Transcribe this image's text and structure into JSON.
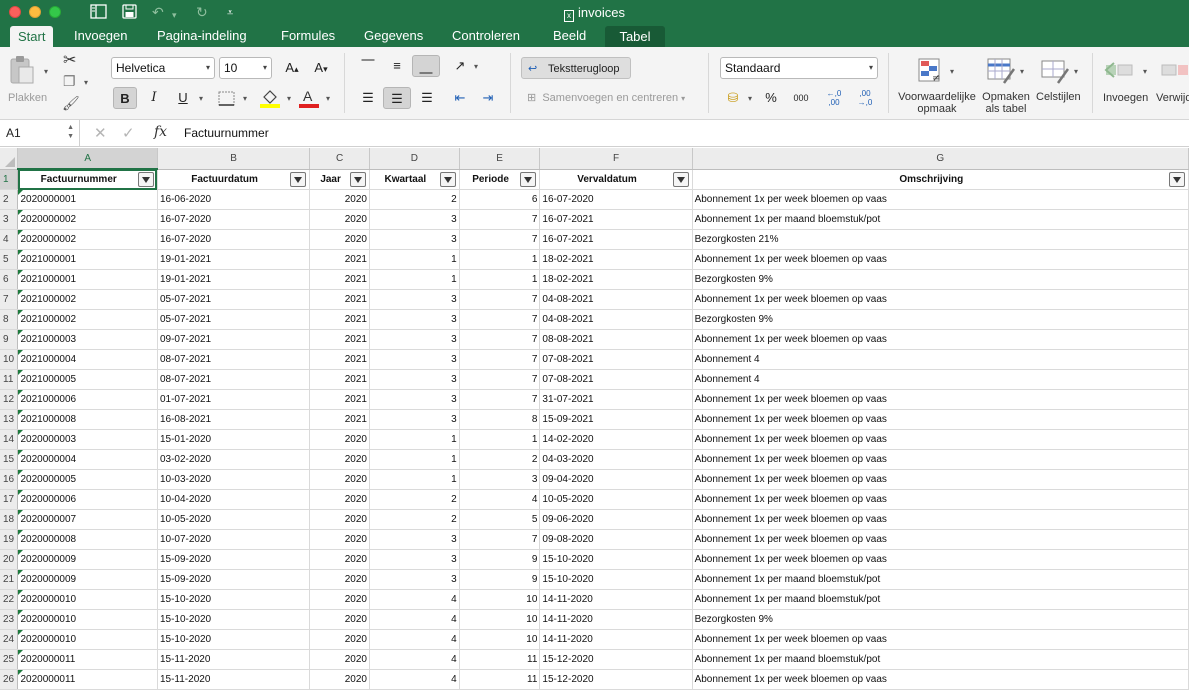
{
  "window": {
    "title": "invoices",
    "colors": {
      "chrome": "#217346",
      "accent": "#217346"
    }
  },
  "quick_access": {
    "icons": [
      "sidebar-icon",
      "save-icon",
      "undo-icon",
      "redo-icon",
      "customize-icon"
    ]
  },
  "tabs": [
    "Start",
    "Invoegen",
    "Pagina-indeling",
    "Formules",
    "Gegevens",
    "Controleren",
    "Beeld",
    "Tabel"
  ],
  "ribbon": {
    "paste_label": "Plakken",
    "font_name": "Helvetica",
    "font_size": "10",
    "wrap_text_label": "Tekstterugloop",
    "merge_label": "Samenvoegen en centreren",
    "number_format": "Standaard",
    "percent_symbol": "%",
    "thousands_symbol": "000",
    "conditional_label": "Voorwaardelijke opmaak",
    "format_table_label": "Opmaken als tabel",
    "cell_styles_label": "Celstijlen",
    "insert_label": "Invoegen",
    "delete_label": "Verwijd"
  },
  "formula_bar": {
    "name_box": "A1",
    "fx_label": "fx",
    "value": "Factuurnummer"
  },
  "sheet": {
    "columns": [
      "A",
      "B",
      "C",
      "D",
      "E",
      "F",
      "G"
    ],
    "headers": [
      "Factuurnummer",
      "Factuurdatum",
      "Jaar",
      "Kwartaal",
      "Periode",
      "Vervaldatum",
      "Omschrijving"
    ],
    "rows": [
      [
        "2020000001",
        "16-06-2020",
        "2020",
        "2",
        "6",
        "16-07-2020",
        "Abonnement 1x per week bloemen op vaas"
      ],
      [
        "2020000002",
        "16-07-2020",
        "2020",
        "3",
        "7",
        "16-07-2021",
        "Abonnement 1x per maand bloemstuk/pot"
      ],
      [
        "2020000002",
        "16-07-2020",
        "2020",
        "3",
        "7",
        "16-07-2021",
        "Bezorgkosten 21%"
      ],
      [
        "2021000001",
        "19-01-2021",
        "2021",
        "1",
        "1",
        "18-02-2021",
        "Abonnement 1x per week bloemen op vaas"
      ],
      [
        "2021000001",
        "19-01-2021",
        "2021",
        "1",
        "1",
        "18-02-2021",
        "Bezorgkosten 9%"
      ],
      [
        "2021000002",
        "05-07-2021",
        "2021",
        "3",
        "7",
        "04-08-2021",
        "Abonnement 1x per week bloemen op vaas"
      ],
      [
        "2021000002",
        "05-07-2021",
        "2021",
        "3",
        "7",
        "04-08-2021",
        "Bezorgkosten 9%"
      ],
      [
        "2021000003",
        "09-07-2021",
        "2021",
        "3",
        "7",
        "08-08-2021",
        "Abonnement 1x per week bloemen op vaas"
      ],
      [
        "2021000004",
        "08-07-2021",
        "2021",
        "3",
        "7",
        "07-08-2021",
        "Abonnement 4"
      ],
      [
        "2021000005",
        "08-07-2021",
        "2021",
        "3",
        "7",
        "07-08-2021",
        "Abonnement 4"
      ],
      [
        "2021000006",
        "01-07-2021",
        "2021",
        "3",
        "7",
        "31-07-2021",
        "Abonnement 1x per week bloemen op vaas"
      ],
      [
        "2021000008",
        "16-08-2021",
        "2021",
        "3",
        "8",
        "15-09-2021",
        "Abonnement 1x per week bloemen op vaas"
      ],
      [
        "2020000003",
        "15-01-2020",
        "2020",
        "1",
        "1",
        "14-02-2020",
        "Abonnement 1x per week bloemen op vaas"
      ],
      [
        "2020000004",
        "03-02-2020",
        "2020",
        "1",
        "2",
        "04-03-2020",
        "Abonnement 1x per week bloemen op vaas"
      ],
      [
        "2020000005",
        "10-03-2020",
        "2020",
        "1",
        "3",
        "09-04-2020",
        "Abonnement 1x per week bloemen op vaas"
      ],
      [
        "2020000006",
        "10-04-2020",
        "2020",
        "2",
        "4",
        "10-05-2020",
        "Abonnement 1x per week bloemen op vaas"
      ],
      [
        "2020000007",
        "10-05-2020",
        "2020",
        "2",
        "5",
        "09-06-2020",
        "Abonnement 1x per week bloemen op vaas"
      ],
      [
        "2020000008",
        "10-07-2020",
        "2020",
        "3",
        "7",
        "09-08-2020",
        "Abonnement 1x per week bloemen op vaas"
      ],
      [
        "2020000009",
        "15-09-2020",
        "2020",
        "3",
        "9",
        "15-10-2020",
        "Abonnement 1x per week bloemen op vaas"
      ],
      [
        "2020000009",
        "15-09-2020",
        "2020",
        "3",
        "9",
        "15-10-2020",
        "Abonnement 1x per maand bloemstuk/pot"
      ],
      [
        "2020000010",
        "15-10-2020",
        "2020",
        "4",
        "10",
        "14-11-2020",
        "Abonnement 1x per maand bloemstuk/pot"
      ],
      [
        "2020000010",
        "15-10-2020",
        "2020",
        "4",
        "10",
        "14-11-2020",
        "Bezorgkosten 9%"
      ],
      [
        "2020000010",
        "15-10-2020",
        "2020",
        "4",
        "10",
        "14-11-2020",
        "Abonnement 1x per week bloemen op vaas"
      ],
      [
        "2020000011",
        "15-11-2020",
        "2020",
        "4",
        "11",
        "15-12-2020",
        "Abonnement 1x per maand bloemstuk/pot"
      ],
      [
        "2020000011",
        "15-11-2020",
        "2020",
        "4",
        "11",
        "15-12-2020",
        "Abonnement 1x per week bloemen op vaas"
      ]
    ]
  }
}
